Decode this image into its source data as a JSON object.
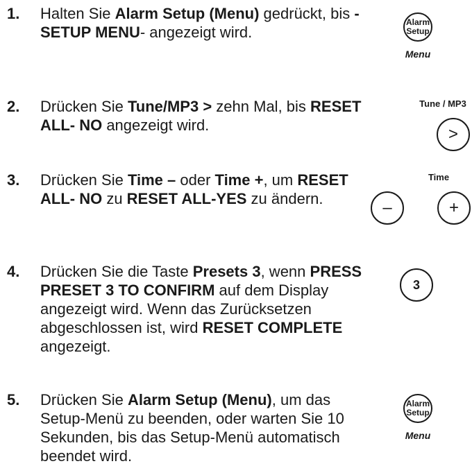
{
  "steps": [
    {
      "number": "1.",
      "parts": [
        {
          "t": "Halten Sie ",
          "b": false
        },
        {
          "t": "Alarm Setup (Menu)",
          "b": true
        },
        {
          "t": " gedrückt, bis ",
          "b": false
        },
        {
          "t": "-SETUP MENU",
          "b": true
        },
        {
          "t": "- angezeigt wird.",
          "b": false
        }
      ]
    },
    {
      "number": "2.",
      "parts": [
        {
          "t": "Drücken Sie ",
          "b": false
        },
        {
          "t": "Tune/MP3 >",
          "b": true
        },
        {
          "t": " zehn Mal, bis ",
          "b": false
        },
        {
          "t": "RESET ALL- NO",
          "b": true
        },
        {
          "t": " angezeigt wird.",
          "b": false
        }
      ]
    },
    {
      "number": "3.",
      "parts": [
        {
          "t": "Drücken Sie ",
          "b": false
        },
        {
          "t": "Time –",
          "b": true
        },
        {
          "t": " oder ",
          "b": false
        },
        {
          "t": "Time +",
          "b": true
        },
        {
          "t": ", um ",
          "b": false
        },
        {
          "t": "RESET ALL- NO",
          "b": true
        },
        {
          "t": " zu ",
          "b": false
        },
        {
          "t": "RESET ALL-YES",
          "b": true
        },
        {
          "t": " zu ändern.",
          "b": false
        }
      ]
    },
    {
      "number": "4.",
      "parts": [
        {
          "t": "Drücken Sie die Taste ",
          "b": false
        },
        {
          "t": "Presets 3",
          "b": true
        },
        {
          "t": ", wenn ",
          "b": false
        },
        {
          "t": "PRESS PRESET 3 TO CONFIRM",
          "b": true
        },
        {
          "t": " auf dem Display angezeigt wird. Wenn das Zurücksetzen abgeschlossen ist, wird ",
          "b": false
        },
        {
          "t": "RESET COMPLETE",
          "b": true
        },
        {
          "t": " angezeigt.",
          "b": false
        }
      ]
    },
    {
      "number": "5.",
      "parts": [
        {
          "t": "Drücken Sie ",
          "b": false
        },
        {
          "t": "Alarm Setup (Menu)",
          "b": true
        },
        {
          "t": ", um das Setup-Menü zu beenden, oder warten Sie 10 Sekunden, bis das Setup-Menü automatisch beendet wird.",
          "b": false
        }
      ]
    }
  ],
  "icons": {
    "alarm_line1": "Alarm",
    "alarm_line2": "Setup",
    "menu_label": "Menu",
    "tune_label": "Tune / MP3",
    "tune_symbol": ">",
    "time_label": "Time",
    "minus_symbol": "–",
    "plus_symbol": "+",
    "preset_label": "3"
  }
}
